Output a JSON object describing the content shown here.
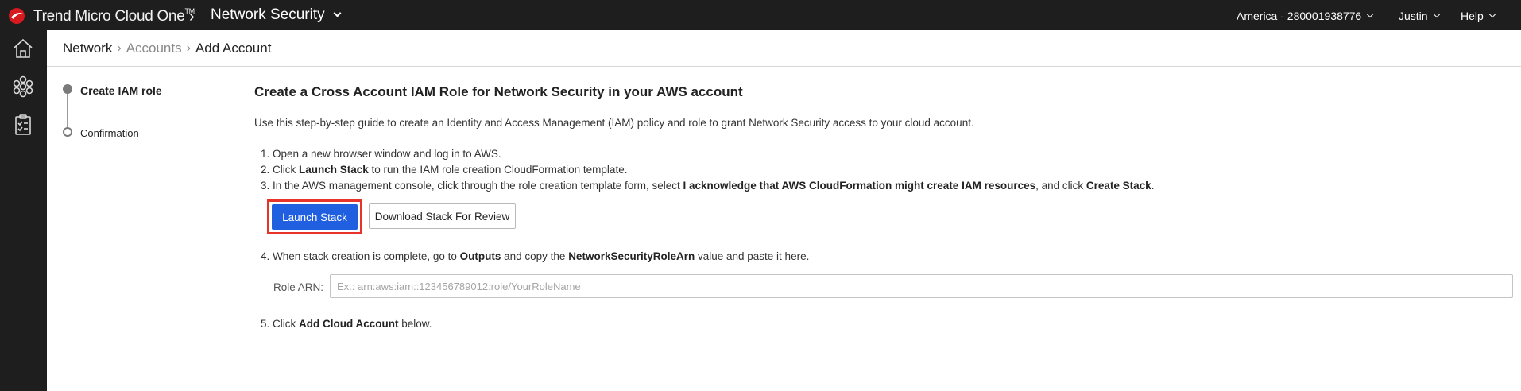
{
  "topbar": {
    "brand": "Trend Micro Cloud One",
    "brand_tm": "TM",
    "product": "Network Security",
    "account": "America - 280001938776",
    "user": "Justin",
    "help": "Help",
    "brand_color": "#d71920"
  },
  "rail": {
    "icons": [
      "home-icon",
      "hexagon-cluster-icon",
      "checklist-icon"
    ]
  },
  "breadcrumb": {
    "items": [
      "Network",
      "Accounts",
      "Add Account"
    ],
    "separator": "›"
  },
  "steps": [
    {
      "label": "Create IAM role",
      "state": "active"
    },
    {
      "label": "Confirmation",
      "state": "pending"
    }
  ],
  "main": {
    "title": "Create a Cross Account IAM Role for Network Security in your AWS account",
    "intro": "Use this step-by-step guide to create an Identity and Access Management (IAM) policy and role to grant Network Security access to your cloud account.",
    "step1": "1. Open a new browser window and log in to AWS.",
    "step2_prefix": "2. Click ",
    "step2_bold": "Launch Stack",
    "step2_suffix": " to run the IAM role creation CloudFormation template.",
    "step3_prefix": "3. In the AWS management console, click through the role creation template form, select ",
    "step3_bold1": "I acknowledge that AWS CloudFormation might create IAM resources",
    "step3_mid": ", and click ",
    "step3_bold2": "Create Stack",
    "step3_suffix": ".",
    "launch_button": "Launch Stack",
    "download_button": "Download Stack For Review",
    "step4_prefix": "4. When stack creation is complete, go to ",
    "step4_bold1": "Outputs",
    "step4_mid": " and copy the ",
    "step4_bold2": "NetworkSecurityRoleArn",
    "step4_suffix": " value and paste it here.",
    "role_label": "Role ARN:",
    "role_value": "",
    "role_placeholder": "Ex.: arn:aws:iam::123456789012:role/YourRoleName",
    "step5_prefix": "5. Click ",
    "step5_bold": "Add Cloud Account",
    "step5_suffix": " below.",
    "accent_color": "#1f5fe0",
    "highlight_color": "#e8332b"
  }
}
